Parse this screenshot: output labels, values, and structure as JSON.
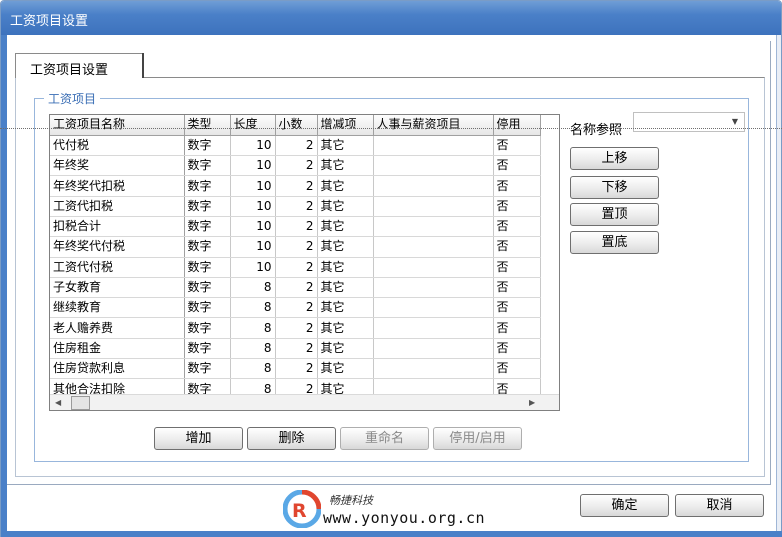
{
  "window": {
    "title": "工资项目设置"
  },
  "tabs": [
    {
      "label": "工资项目设置"
    }
  ],
  "group": {
    "title": "工资项目"
  },
  "grid": {
    "columns": [
      "工资项目名称",
      "类型",
      "长度",
      "小数",
      "增减项",
      "人事与薪资项目",
      "停用"
    ],
    "rows": [
      [
        "代付税",
        "数字",
        "10",
        "2",
        "其它",
        "",
        "否"
      ],
      [
        "年终奖",
        "数字",
        "10",
        "2",
        "其它",
        "",
        "否"
      ],
      [
        "年终奖代扣税",
        "数字",
        "10",
        "2",
        "其它",
        "",
        "否"
      ],
      [
        "工资代扣税",
        "数字",
        "10",
        "2",
        "其它",
        "",
        "否"
      ],
      [
        "扣税合计",
        "数字",
        "10",
        "2",
        "其它",
        "",
        "否"
      ],
      [
        "年终奖代付税",
        "数字",
        "10",
        "2",
        "其它",
        "",
        "否"
      ],
      [
        "工资代付税",
        "数字",
        "10",
        "2",
        "其它",
        "",
        "否"
      ],
      [
        "子女教育",
        "数字",
        "8",
        "2",
        "其它",
        "",
        "否"
      ],
      [
        "继续教育",
        "数字",
        "8",
        "2",
        "其它",
        "",
        "否"
      ],
      [
        "老人赡养费",
        "数字",
        "8",
        "2",
        "其它",
        "",
        "否"
      ],
      [
        "住房租金",
        "数字",
        "8",
        "2",
        "其它",
        "",
        "否"
      ],
      [
        "住房贷款利息",
        "数字",
        "8",
        "2",
        "其它",
        "",
        "否"
      ],
      [
        "其他合法扣除",
        "数字",
        "8",
        "2",
        "其它",
        "",
        "否"
      ]
    ]
  },
  "name_reference": {
    "label": "名称参照",
    "value": ""
  },
  "side_buttons": {
    "move_up": "上移",
    "move_down": "下移",
    "to_top": "置顶",
    "to_bottom": "置底"
  },
  "bottom_buttons": {
    "add": "增加",
    "delete": "删除",
    "rename": "重命名",
    "toggle": "停用/启用"
  },
  "footer_buttons": {
    "ok": "确定",
    "cancel": "取消"
  },
  "watermark": {
    "brand": "畅捷科技",
    "url": "www.yonyou.org.cn"
  },
  "colors": {
    "title_bar": "#4a80c8",
    "group_title": "#3a6eb5"
  }
}
